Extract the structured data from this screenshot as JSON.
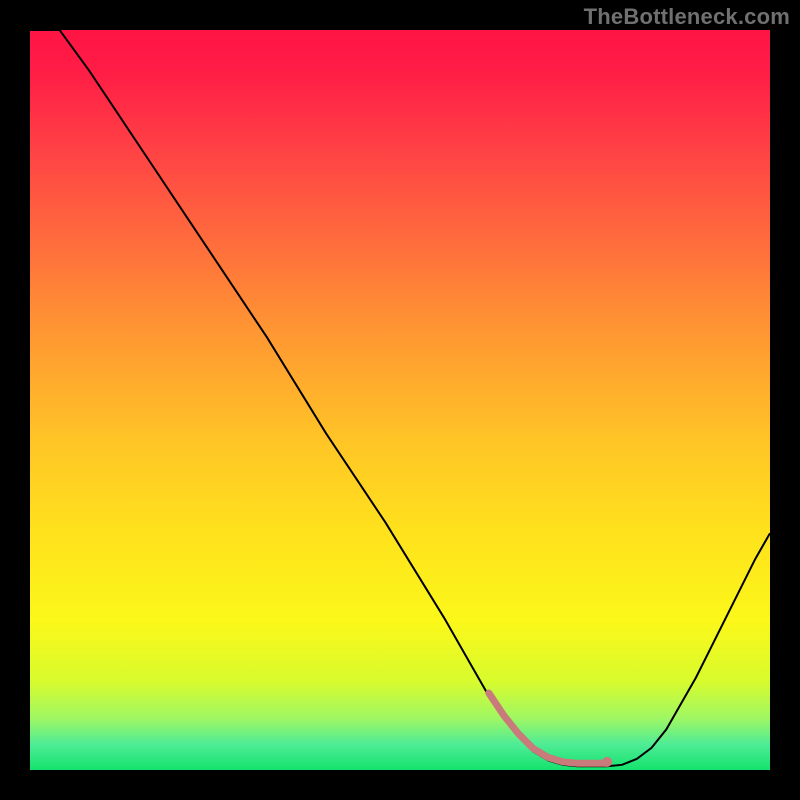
{
  "watermark": {
    "text": "TheBottleneck.com"
  },
  "colors": {
    "background": "#000000",
    "curve": "#000000",
    "marker": "#c97b7b",
    "gradient_stops": [
      {
        "offset": 0.0,
        "color": "#ff1444"
      },
      {
        "offset": 0.06,
        "color": "#ff1e46"
      },
      {
        "offset": 0.16,
        "color": "#ff4145"
      },
      {
        "offset": 0.28,
        "color": "#ff6a3d"
      },
      {
        "offset": 0.4,
        "color": "#ff9433"
      },
      {
        "offset": 0.56,
        "color": "#ffc626"
      },
      {
        "offset": 0.68,
        "color": "#ffe21c"
      },
      {
        "offset": 0.8,
        "color": "#fbf81a"
      },
      {
        "offset": 0.88,
        "color": "#d8fb2d"
      },
      {
        "offset": 0.93,
        "color": "#9ff763"
      },
      {
        "offset": 0.965,
        "color": "#4fec96"
      },
      {
        "offset": 1.0,
        "color": "#14e26d"
      }
    ]
  },
  "chart_data": {
    "type": "line",
    "title": "",
    "xlabel": "",
    "ylabel": "",
    "xlim": [
      0,
      100
    ],
    "ylim": [
      0,
      100
    ],
    "grid": false,
    "legend": false,
    "series": [
      {
        "name": "bottleneck-curve",
        "x": [
          0,
          4,
          8,
          12,
          16,
          20,
          24,
          28,
          32,
          36,
          40,
          44,
          48,
          52,
          56,
          60,
          62,
          64,
          66,
          68,
          70,
          72,
          74,
          76,
          78,
          80,
          82,
          84,
          86,
          88,
          90,
          92,
          94,
          96,
          98,
          100
        ],
        "values": [
          100,
          100,
          94.5,
          88.5,
          82.5,
          76.5,
          70.5,
          64.5,
          58.5,
          52.0,
          45.5,
          39.5,
          33.5,
          27.0,
          20.5,
          13.5,
          10.0,
          7.0,
          4.5,
          2.5,
          1.3,
          0.7,
          0.5,
          0.5,
          0.5,
          0.7,
          1.5,
          3.0,
          5.5,
          9.0,
          12.5,
          16.5,
          20.5,
          24.5,
          28.5,
          32.0
        ]
      }
    ],
    "marker_region": {
      "x_start": 62,
      "x_end": 78
    },
    "marker_point": {
      "x": 78,
      "y": 0.7
    }
  }
}
